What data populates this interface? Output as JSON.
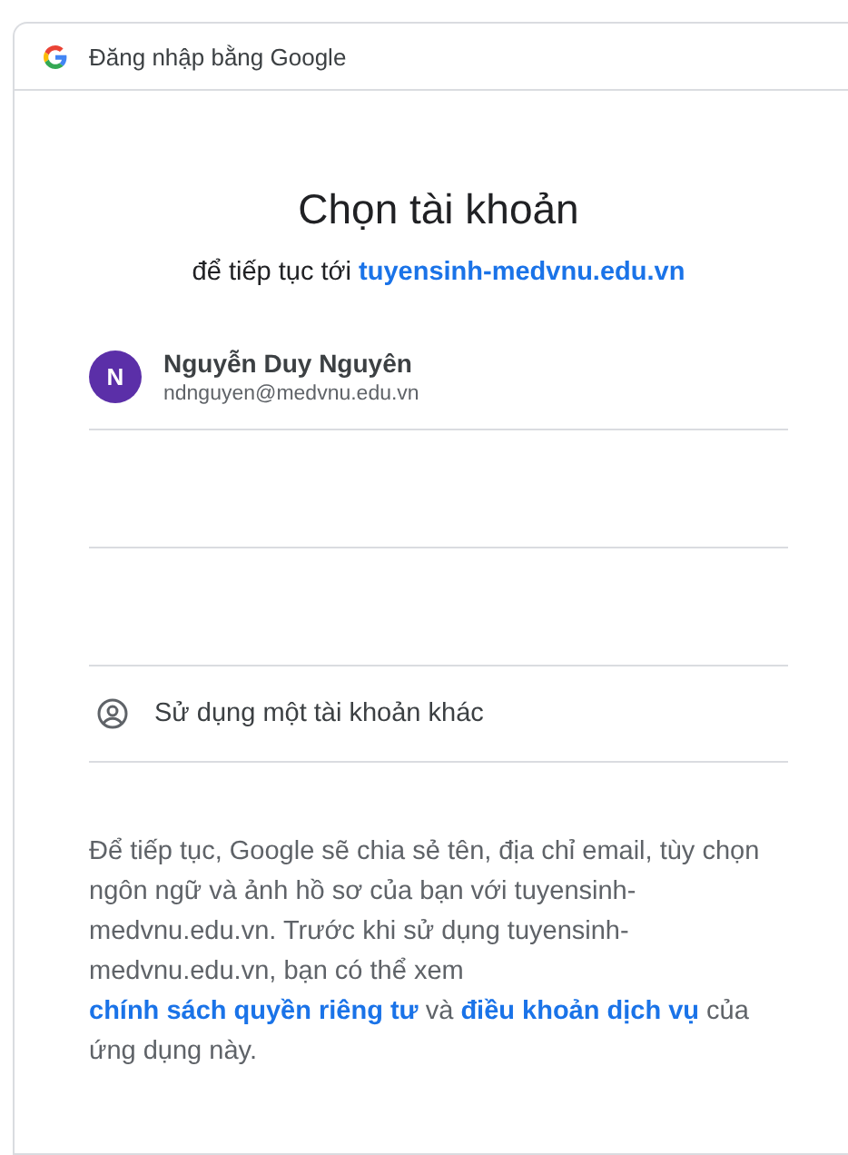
{
  "header": {
    "title": "Đăng nhập bằng Google"
  },
  "heading": "Chọn tài khoản",
  "subtitle": {
    "text": "để tiếp tục tới",
    "link": "tuyensinh-medvnu.edu.vn"
  },
  "accounts": [
    {
      "initial": "N",
      "name": "Nguyễn Duy Nguyên",
      "email": "ndnguyen@medvnu.edu.vn"
    }
  ],
  "use_another": "Sử dụng một tài khoản khác",
  "disclosure": [
    {
      "kind": "text",
      "text": "Để tiếp tục, Google sẽ chia sẻ tên, địa chỉ email, tùy chọn ngôn ngữ và ảnh hồ sơ của bạn với tuyensinh-medvnu.edu.vn. Trước khi sử dụng tuyensinh-medvnu.edu.vn, bạn có thể xem "
    },
    {
      "kind": "link",
      "text": "chính sách quyền riêng tư"
    },
    {
      "kind": "text",
      "text": " và "
    },
    {
      "kind": "link",
      "text": "điều khoản dịch vụ"
    },
    {
      "kind": "text",
      "text": " của ứng dụng này."
    }
  ]
}
